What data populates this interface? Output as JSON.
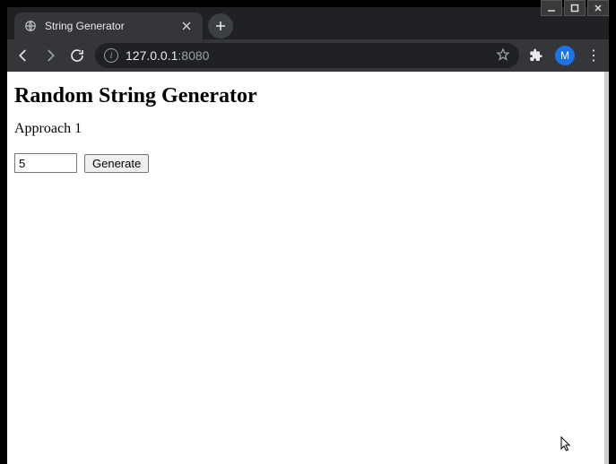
{
  "window": {
    "profile_initial": "M"
  },
  "tab": {
    "title": "String Generator"
  },
  "omnibox": {
    "host": "127.0.0.1",
    "port": ":8080"
  },
  "page": {
    "heading": "Random String Generator",
    "subheading": "Approach 1",
    "input_value": "5",
    "button_label": "Generate"
  }
}
